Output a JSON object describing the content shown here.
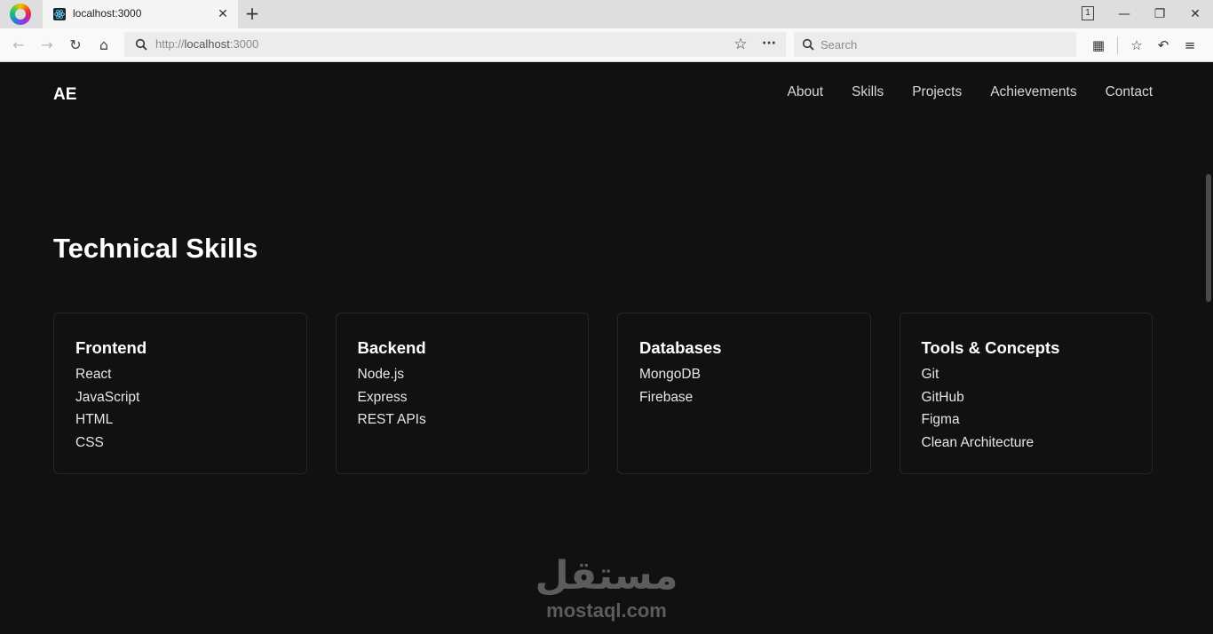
{
  "browser": {
    "tab": {
      "title": "localhost:3000",
      "close": "✕"
    },
    "new_tab": "+",
    "tab_count": "1",
    "window_controls": {
      "minimize": "—",
      "restore": "❐",
      "close": "✕"
    },
    "nav": {
      "back": "←",
      "forward": "→",
      "reload": "↻",
      "home": "⌂"
    },
    "url": {
      "scheme": "http://",
      "host": "localhost",
      "port": ":3000"
    },
    "bookmark_star": "☆",
    "page_actions": "···",
    "search": {
      "placeholder": "Search"
    },
    "toolbar": {
      "library": "▦",
      "reading_list": "☆",
      "undo": "↶",
      "menu": "≡"
    }
  },
  "site": {
    "logo": "AE",
    "nav": [
      "About",
      "Skills",
      "Projects",
      "Achievements",
      "Contact"
    ]
  },
  "skills": {
    "title": "Technical Skills",
    "cards": [
      {
        "heading": "Frontend",
        "items": [
          "React",
          "JavaScript",
          "HTML",
          "CSS"
        ]
      },
      {
        "heading": "Backend",
        "items": [
          "Node.js",
          "Express",
          "REST APIs"
        ]
      },
      {
        "heading": "Databases",
        "items": [
          "MongoDB",
          "Firebase"
        ]
      },
      {
        "heading": "Tools & Concepts",
        "items": [
          "Git",
          "GitHub",
          "Figma",
          "Clean Architecture"
        ]
      }
    ]
  },
  "watermark": {
    "arabic": "مستقل",
    "latin": "mostaql.com"
  }
}
